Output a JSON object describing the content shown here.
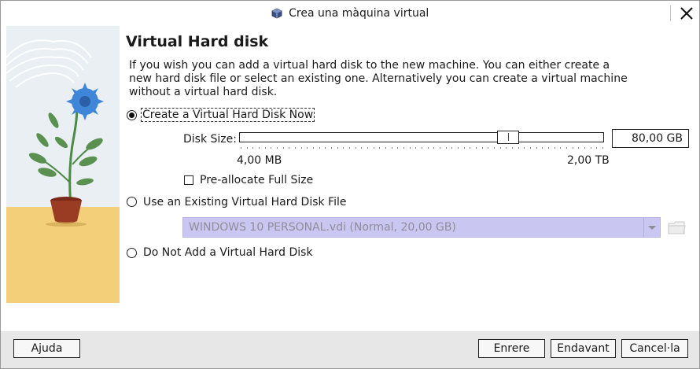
{
  "window": {
    "title": "Crea una màquina virtual",
    "app_icon": "virtualbox-icon",
    "close_icon": "close-icon"
  },
  "page": {
    "heading": "Virtual Hard disk",
    "description": "If you wish you can add a virtual hard disk to the new machine. You can either create a new hard disk file or select an existing one. Alternatively you can create a virtual machine without a virtual hard disk."
  },
  "options": {
    "create_now": {
      "label": "Create a Virtual Hard Disk Now",
      "selected": true
    },
    "use_existing": {
      "label": "Use an Existing Virtual Hard Disk File",
      "selected": false
    },
    "no_disk": {
      "label": "Do Not Add a Virtual Hard Disk",
      "selected": false
    }
  },
  "disk_size": {
    "label": "Disk Size:",
    "min_label": "4,00 MB",
    "max_label": "2,00 TB",
    "value": "80,00 GB",
    "slider_position_fraction": 0.75
  },
  "preallocate": {
    "label": "Pre-allocate Full Size",
    "checked": false
  },
  "existing_disk": {
    "selected": "WINDOWS 10 PERSONAL.vdi (Normal, 20,00 GB)",
    "folder_icon": "folder-icon"
  },
  "buttons": {
    "help": "Ajuda",
    "back": "Enrere",
    "next": "Endavant",
    "cancel": "Cancel·la"
  },
  "colors": {
    "combo_bg": "#c9c6f2",
    "footer_bg": "#e7e7e7",
    "flower": "#3f86d8",
    "ground": "#f2cf78"
  }
}
